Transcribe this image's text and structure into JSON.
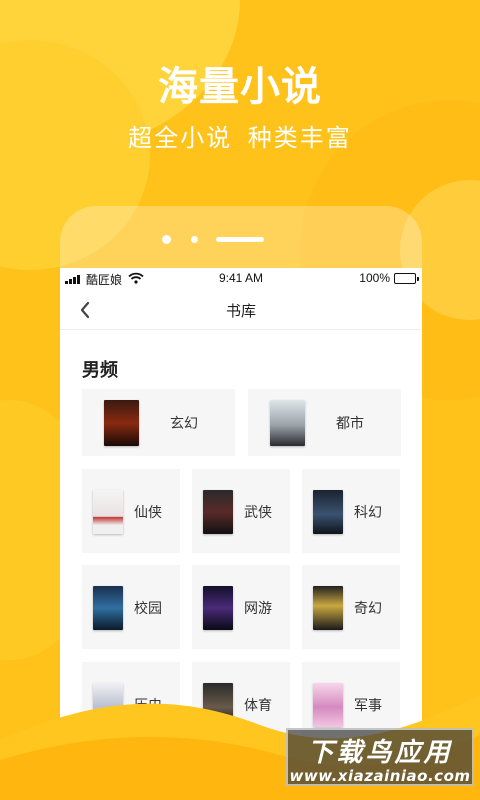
{
  "hero": {
    "title": "海量小说",
    "subtitle": "超全小说 种类丰富"
  },
  "status_bar": {
    "carrier": "酷匠娘",
    "time": "9:41 AM",
    "battery": "100%"
  },
  "nav": {
    "title": "书库",
    "back_icon": "chevron-left-icon"
  },
  "section": {
    "title": "男频"
  },
  "categories": [
    {
      "label": "玄幻"
    },
    {
      "label": "都市"
    },
    {
      "label": "仙侠"
    },
    {
      "label": "武侠"
    },
    {
      "label": "科幻"
    },
    {
      "label": "校园"
    },
    {
      "label": "网游"
    },
    {
      "label": "奇幻"
    },
    {
      "label": "历史"
    },
    {
      "label": "体育"
    },
    {
      "label": "军事"
    }
  ],
  "pager": {
    "current_page": 3,
    "total_pages": 3
  },
  "watermark": {
    "line1": "下载鸟应用",
    "line2": "www.xiazainiao.com"
  },
  "colors": {
    "background": "#FFC21A",
    "card": "#F6F6F6",
    "text": "#333333"
  }
}
